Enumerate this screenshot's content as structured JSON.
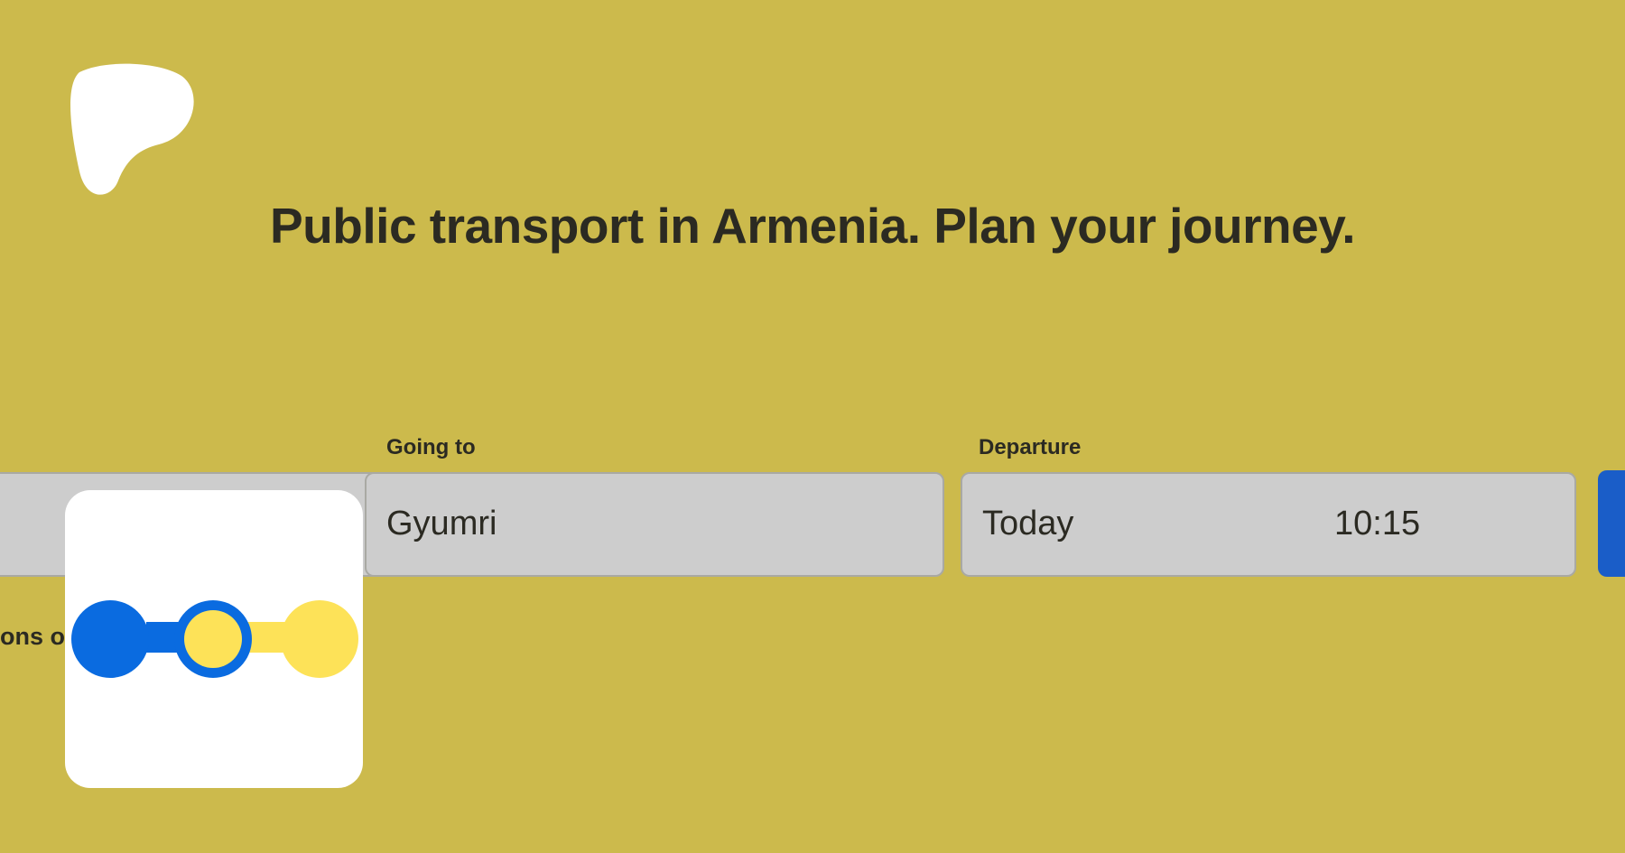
{
  "header": {
    "title": "Public transport in Armenia. Plan your journey."
  },
  "brand": {
    "logo_icon": "brand-blob-logo",
    "app_icon": "route-dots-icon"
  },
  "search_form": {
    "from": {
      "value": ""
    },
    "to": {
      "label": "Going to",
      "value": "Gyumri"
    },
    "departure": {
      "label": "Departure",
      "date": "Today",
      "time": "10:15"
    },
    "search_button": {
      "label": ""
    }
  },
  "partial_text": "ons or",
  "colors": {
    "background": "#CCBA4C",
    "accent_blue": "#1A5DC8",
    "icon_blue": "#0A6BE0",
    "icon_yellow": "#FDE258",
    "input_bg": "#CDCDCD"
  }
}
